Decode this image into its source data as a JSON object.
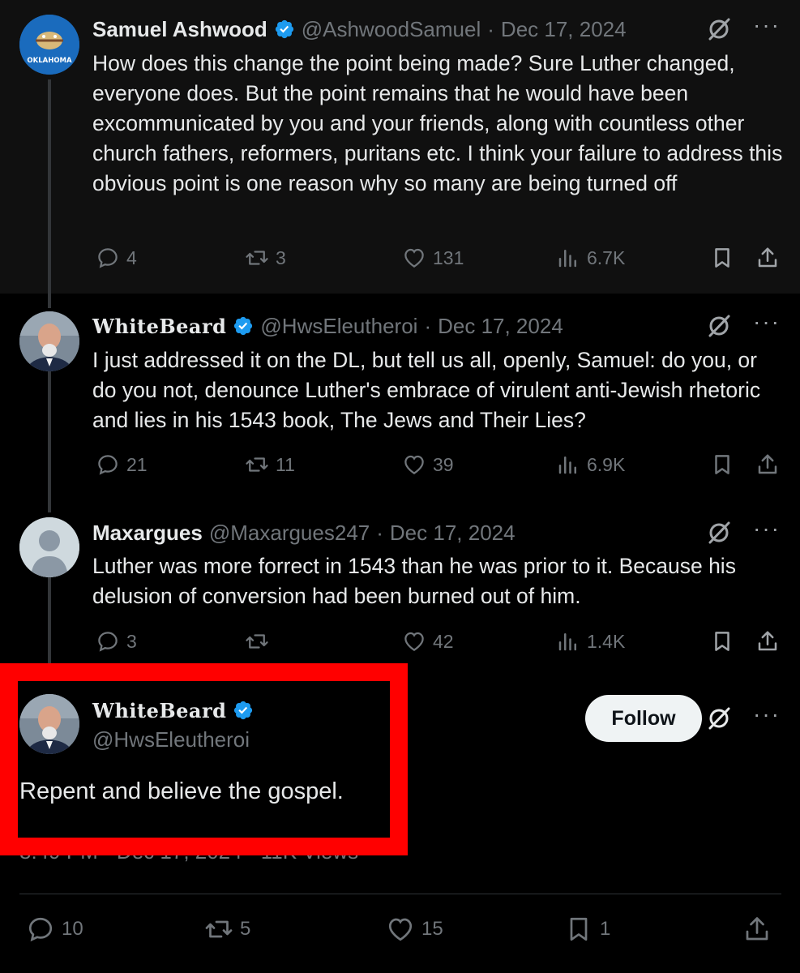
{
  "tweets": [
    {
      "name": "Samuel Ashwood",
      "avatar_text": "OKLAHOMA",
      "handle": "@AshwoodSamuel",
      "date": "Dec 17, 2024",
      "text": "How does this change the point being made? Sure Luther changed, everyone does. But the point remains that he would have been excommunicated by you and your friends, along with countless other church fathers, reformers, puritans etc. I think your failure to address this obvious point is one reason why so many are being turned off",
      "replies": "4",
      "reposts": "3",
      "likes": "131",
      "views": "6.7K"
    },
    {
      "name": "WhiteBeard",
      "handle": "@HwsEleutheroi",
      "date": "Dec 17, 2024",
      "text": "I just addressed it on the DL, but tell us all, openly, Samuel: do you, or do you not, denounce Luther's embrace of virulent anti-Jewish rhetoric and lies in his 1543 book, The Jews and Their Lies?",
      "replies": "21",
      "reposts": "11",
      "likes": "39",
      "views": "6.9K"
    },
    {
      "name": "Maxargues",
      "handle": "@Maxargues247",
      "date": "Dec 17, 2024",
      "text": "Luther was more forrect in 1543 than he was prior to it. Because his delusion of conversion had been burned out of him.",
      "replies": "3",
      "reposts": "",
      "likes": "42",
      "views": "1.4K"
    }
  ],
  "main_tweet": {
    "name": "WhiteBeard",
    "handle": "@HwsEleutheroi",
    "follow_label": "Follow",
    "text": "Repent and believe the gospel.",
    "meta": "8:49 PM · Dec 17, 2024 · 11K Views",
    "replies": "10",
    "reposts": "5",
    "likes": "15",
    "bookmarks": "1"
  },
  "separator": "·",
  "more_label": "···",
  "colors": {
    "background": "#000000",
    "verified": "#1d9bf0",
    "highlight": "#ff0000",
    "muted": "#71767b"
  }
}
